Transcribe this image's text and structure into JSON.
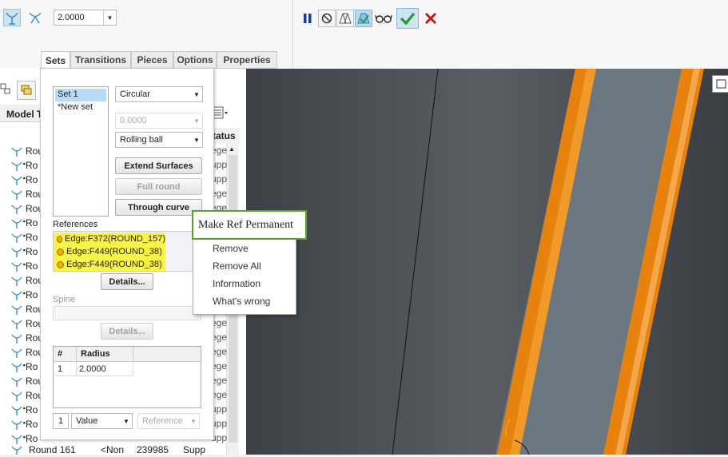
{
  "toolbar": {
    "radius_value": "2.0000",
    "icons": [
      "round-set-icon",
      "round-transition-icon",
      "pause-icon",
      "no-preview-icon",
      "geometry-preview-icon",
      "verify-icon",
      "glasses-icon",
      "ok-check-icon",
      "cancel-x-icon"
    ]
  },
  "tabs": [
    "Sets",
    "Transitions",
    "Pieces",
    "Options",
    "Properties"
  ],
  "model_tree": {
    "header": "Model T",
    "status_header": "tatus",
    "rows": [
      {
        "label": "Rou",
        "status": "ege"
      },
      {
        "label": "Ro",
        "status": "upp"
      },
      {
        "label": "Ro",
        "status": "upp"
      },
      {
        "label": "Rou",
        "status": "ege"
      },
      {
        "label": "Rou",
        "status": "ege"
      },
      {
        "label": "Ro",
        "status": "upp"
      },
      {
        "label": "Ro",
        "status": "ege"
      },
      {
        "label": "Ro",
        "status": "upp"
      },
      {
        "label": "Ro",
        "status": "upp"
      },
      {
        "label": "Rou",
        "status": "ege"
      },
      {
        "label": "Ro",
        "status": "upp"
      },
      {
        "label": "Rou",
        "status": "upp"
      },
      {
        "label": "Rou",
        "status": "ege"
      },
      {
        "label": "Rou",
        "status": "ege"
      },
      {
        "label": "Rou",
        "status": "ege"
      },
      {
        "label": "Ro",
        "status": "ege"
      },
      {
        "label": "Rou",
        "status": "ege"
      },
      {
        "label": "Rou",
        "status": "ege"
      },
      {
        "label": "Ro",
        "status": "upp"
      },
      {
        "label": "Ro",
        "status": "upp"
      },
      {
        "label": "Ro",
        "status": "upp"
      }
    ],
    "last_row": {
      "label": "Round 161",
      "col2": "<Non",
      "col3": "239985",
      "status": "Supp"
    }
  },
  "sets_panel": {
    "set_list": [
      "Set 1",
      "*New set"
    ],
    "type_value": "Circular",
    "value_disabled": "0.0000",
    "method_value": "Rolling ball",
    "buttons": {
      "extend_surfaces": "Extend Surfaces",
      "full_round": "Full round",
      "through_curve": "Through curve"
    },
    "references_label": "References",
    "references": [
      "Edge:F372(ROUND_157)",
      "Edge:F449(ROUND_38)",
      "Edge:F449(ROUND_38)"
    ],
    "details_label": "Details...",
    "spine_label": "Spine",
    "spine_details_label": "Details...",
    "radius_table": {
      "headers": [
        "#",
        "Radius"
      ],
      "rows": [
        {
          "num": "1",
          "radius": "2.0000"
        }
      ]
    },
    "bottom": {
      "index": "1",
      "value_type": "Value",
      "reference": "Reference"
    }
  },
  "context_menu": {
    "tooltip": "Make Ref Permanent",
    "items": [
      "Remove",
      "Remove All",
      "Information",
      "What's wrong"
    ]
  },
  "colors": {
    "viewport_bg": "#3e4247",
    "orange": "#e8820e",
    "selection": "#f8f24a",
    "accent_green": "#5aa02c"
  }
}
